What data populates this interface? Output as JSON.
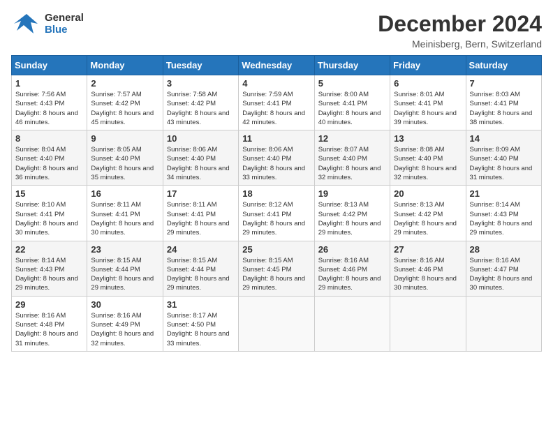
{
  "header": {
    "logo_line1": "General",
    "logo_line2": "Blue",
    "month": "December 2024",
    "location": "Meinisberg, Bern, Switzerland"
  },
  "weekdays": [
    "Sunday",
    "Monday",
    "Tuesday",
    "Wednesday",
    "Thursday",
    "Friday",
    "Saturday"
  ],
  "weeks": [
    [
      {
        "day": "1",
        "sunrise": "7:56 AM",
        "sunset": "4:43 PM",
        "daylight": "8 hours and 46 minutes."
      },
      {
        "day": "2",
        "sunrise": "7:57 AM",
        "sunset": "4:42 PM",
        "daylight": "8 hours and 45 minutes."
      },
      {
        "day": "3",
        "sunrise": "7:58 AM",
        "sunset": "4:42 PM",
        "daylight": "8 hours and 43 minutes."
      },
      {
        "day": "4",
        "sunrise": "7:59 AM",
        "sunset": "4:41 PM",
        "daylight": "8 hours and 42 minutes."
      },
      {
        "day": "5",
        "sunrise": "8:00 AM",
        "sunset": "4:41 PM",
        "daylight": "8 hours and 40 minutes."
      },
      {
        "day": "6",
        "sunrise": "8:01 AM",
        "sunset": "4:41 PM",
        "daylight": "8 hours and 39 minutes."
      },
      {
        "day": "7",
        "sunrise": "8:03 AM",
        "sunset": "4:41 PM",
        "daylight": "8 hours and 38 minutes."
      }
    ],
    [
      {
        "day": "8",
        "sunrise": "8:04 AM",
        "sunset": "4:40 PM",
        "daylight": "8 hours and 36 minutes."
      },
      {
        "day": "9",
        "sunrise": "8:05 AM",
        "sunset": "4:40 PM",
        "daylight": "8 hours and 35 minutes."
      },
      {
        "day": "10",
        "sunrise": "8:06 AM",
        "sunset": "4:40 PM",
        "daylight": "8 hours and 34 minutes."
      },
      {
        "day": "11",
        "sunrise": "8:06 AM",
        "sunset": "4:40 PM",
        "daylight": "8 hours and 33 minutes."
      },
      {
        "day": "12",
        "sunrise": "8:07 AM",
        "sunset": "4:40 PM",
        "daylight": "8 hours and 32 minutes."
      },
      {
        "day": "13",
        "sunrise": "8:08 AM",
        "sunset": "4:40 PM",
        "daylight": "8 hours and 32 minutes."
      },
      {
        "day": "14",
        "sunrise": "8:09 AM",
        "sunset": "4:40 PM",
        "daylight": "8 hours and 31 minutes."
      }
    ],
    [
      {
        "day": "15",
        "sunrise": "8:10 AM",
        "sunset": "4:41 PM",
        "daylight": "8 hours and 30 minutes."
      },
      {
        "day": "16",
        "sunrise": "8:11 AM",
        "sunset": "4:41 PM",
        "daylight": "8 hours and 30 minutes."
      },
      {
        "day": "17",
        "sunrise": "8:11 AM",
        "sunset": "4:41 PM",
        "daylight": "8 hours and 29 minutes."
      },
      {
        "day": "18",
        "sunrise": "8:12 AM",
        "sunset": "4:41 PM",
        "daylight": "8 hours and 29 minutes."
      },
      {
        "day": "19",
        "sunrise": "8:13 AM",
        "sunset": "4:42 PM",
        "daylight": "8 hours and 29 minutes."
      },
      {
        "day": "20",
        "sunrise": "8:13 AM",
        "sunset": "4:42 PM",
        "daylight": "8 hours and 29 minutes."
      },
      {
        "day": "21",
        "sunrise": "8:14 AM",
        "sunset": "4:43 PM",
        "daylight": "8 hours and 29 minutes."
      }
    ],
    [
      {
        "day": "22",
        "sunrise": "8:14 AM",
        "sunset": "4:43 PM",
        "daylight": "8 hours and 29 minutes."
      },
      {
        "day": "23",
        "sunrise": "8:15 AM",
        "sunset": "4:44 PM",
        "daylight": "8 hours and 29 minutes."
      },
      {
        "day": "24",
        "sunrise": "8:15 AM",
        "sunset": "4:44 PM",
        "daylight": "8 hours and 29 minutes."
      },
      {
        "day": "25",
        "sunrise": "8:15 AM",
        "sunset": "4:45 PM",
        "daylight": "8 hours and 29 minutes."
      },
      {
        "day": "26",
        "sunrise": "8:16 AM",
        "sunset": "4:46 PM",
        "daylight": "8 hours and 29 minutes."
      },
      {
        "day": "27",
        "sunrise": "8:16 AM",
        "sunset": "4:46 PM",
        "daylight": "8 hours and 30 minutes."
      },
      {
        "day": "28",
        "sunrise": "8:16 AM",
        "sunset": "4:47 PM",
        "daylight": "8 hours and 30 minutes."
      }
    ],
    [
      {
        "day": "29",
        "sunrise": "8:16 AM",
        "sunset": "4:48 PM",
        "daylight": "8 hours and 31 minutes."
      },
      {
        "day": "30",
        "sunrise": "8:16 AM",
        "sunset": "4:49 PM",
        "daylight": "8 hours and 32 minutes."
      },
      {
        "day": "31",
        "sunrise": "8:17 AM",
        "sunset": "4:50 PM",
        "daylight": "8 hours and 33 minutes."
      },
      null,
      null,
      null,
      null
    ]
  ]
}
